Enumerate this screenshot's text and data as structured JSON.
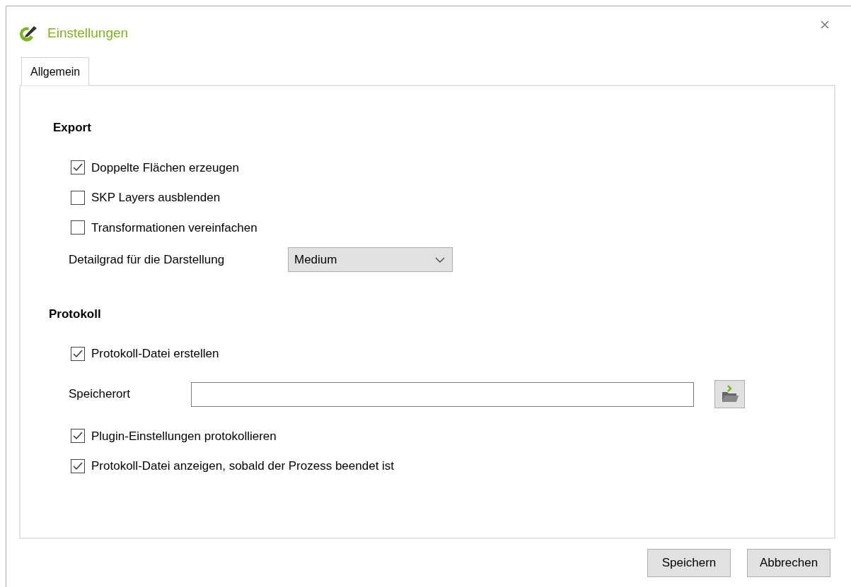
{
  "window": {
    "title": "Einstellungen"
  },
  "tabs": [
    {
      "label": "Allgemein",
      "selected": true
    }
  ],
  "sections": [
    {
      "title": "Export",
      "items": [
        {
          "kind": "checkbox",
          "label": "Doppelte Flächen erzeugen",
          "checked": true
        },
        {
          "kind": "checkbox",
          "label": "SKP Layers ausblenden",
          "checked": false
        },
        {
          "kind": "checkbox",
          "label": "Transformationen vereinfachen",
          "checked": false
        },
        {
          "kind": "select",
          "label": "Detailgrad für die Darstellung",
          "value": "Medium"
        }
      ]
    },
    {
      "title": "Protokoll",
      "items": [
        {
          "kind": "checkbox",
          "label": "Protokoll-Datei erstellen",
          "checked": true
        },
        {
          "kind": "path",
          "label": "Speicherort"
        },
        {
          "kind": "checkbox",
          "label": "Plugin-Einstellungen protokollieren",
          "checked": true
        },
        {
          "kind": "checkbox",
          "label": "Protokoll-Datei anzeigen, sobald der Prozess beendet ist",
          "checked": true
        }
      ]
    }
  ],
  "buttons": [
    "Speichern",
    "Abbrechen"
  ]
}
